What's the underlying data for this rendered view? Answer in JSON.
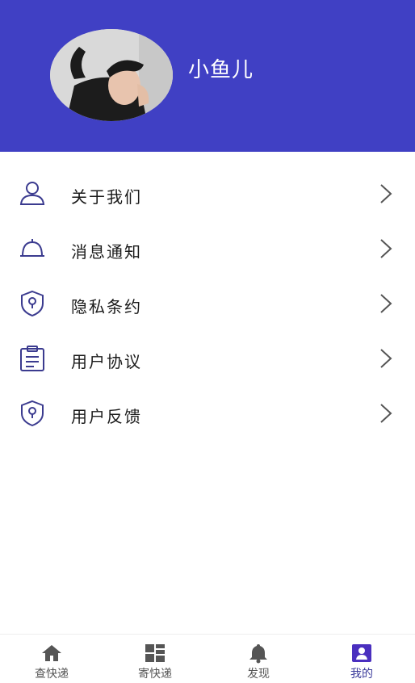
{
  "profile": {
    "username": "小鱼儿"
  },
  "menu": {
    "items": [
      {
        "label": "关于我们",
        "icon": "user-icon"
      },
      {
        "label": "消息通知",
        "icon": "bell-icon"
      },
      {
        "label": "隐私条约",
        "icon": "shield-icon"
      },
      {
        "label": "用户协议",
        "icon": "clipboard-icon"
      },
      {
        "label": "用户反馈",
        "icon": "shield-icon"
      }
    ]
  },
  "tabbar": {
    "tabs": [
      {
        "label": "查快递",
        "icon": "home-icon"
      },
      {
        "label": "寄快递",
        "icon": "grid-icon"
      },
      {
        "label": "发现",
        "icon": "bell-icon"
      },
      {
        "label": "我的",
        "icon": "profile-icon",
        "active": true
      }
    ]
  },
  "colors": {
    "header": "#4040c4",
    "accent": "#3a3a9a",
    "icon_stroke": "#3b3b8f"
  }
}
